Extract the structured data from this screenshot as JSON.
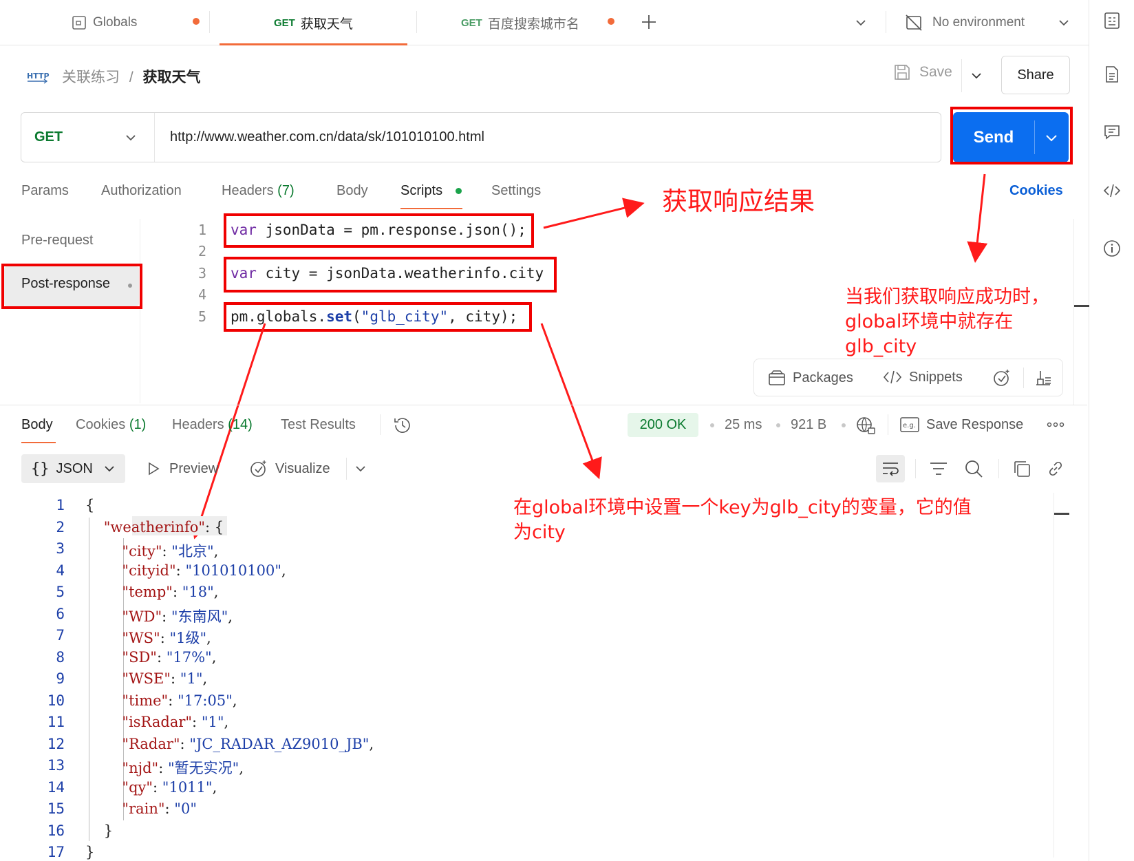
{
  "tabs": [
    {
      "label": "Globals",
      "method": "",
      "dirty": true
    },
    {
      "label": "获取天气",
      "method": "GET",
      "dirty": false,
      "active": true
    },
    {
      "label": "百度搜索城市名",
      "method": "GET",
      "dirty": true
    }
  ],
  "environment": {
    "label": "No environment"
  },
  "breadcrumb": {
    "protocol": "HTTP",
    "collection": "关联练习",
    "separator": "/",
    "request": "获取天气"
  },
  "toolbar": {
    "save_label": "Save",
    "share_label": "Share"
  },
  "request": {
    "method": "GET",
    "url": "http://www.weather.com.cn/data/sk/101010100.html",
    "send_label": "Send",
    "tabs": [
      {
        "label": "Params"
      },
      {
        "label": "Authorization"
      },
      {
        "label": "Headers",
        "count": "(7)"
      },
      {
        "label": "Body"
      },
      {
        "label": "Scripts"
      },
      {
        "label": "Settings"
      }
    ],
    "cookies_label": "Cookies"
  },
  "scripts": {
    "pre_label": "Pre-request",
    "post_label": "Post-response",
    "line_numbers": [
      "1",
      "2",
      "3",
      "4",
      "5"
    ],
    "lines": [
      "var jsonData = pm.response.json();",
      "",
      "var city = jsonData.weatherinfo.city",
      "",
      "pm.globals.set(\"glb_city\", city);"
    ]
  },
  "snippets_bar": {
    "packages_label": "Packages",
    "snippets_label": "Snippets"
  },
  "annotations": {
    "response_result": "获取响应结果",
    "success_note": [
      "当我们获取响应成功时，",
      "global环境中就存在",
      "glb_city"
    ],
    "set_note": [
      "在global环境中设置一个key为glb_city的变量，它的值",
      "为city"
    ]
  },
  "response": {
    "tabs": [
      {
        "label": "Body"
      },
      {
        "label": "Cookies",
        "count": "(1)"
      },
      {
        "label": "Headers",
        "count": "(14)"
      },
      {
        "label": "Test Results"
      }
    ],
    "status": "200 OK",
    "time": "25 ms",
    "size": "921 B",
    "save_label": "Save Response",
    "format": "JSON",
    "preview_label": "Preview",
    "visualize_label": "Visualize",
    "json_line_numbers": [
      "1",
      "2",
      "3",
      "4",
      "5",
      "6",
      "7",
      "8",
      "9",
      "10",
      "11",
      "12",
      "13",
      "14",
      "15",
      "16",
      "17"
    ],
    "json_lines": [
      "{",
      "    \"weatherinfo\": {",
      "        \"city\": \"北京\",",
      "        \"cityid\": \"101010100\",",
      "        \"temp\": \"18\",",
      "        \"WD\": \"东南风\",",
      "        \"WS\": \"1级\",",
      "        \"SD\": \"17%\",",
      "        \"WSE\": \"1\",",
      "        \"time\": \"17:05\",",
      "        \"isRadar\": \"1\",",
      "        \"Radar\": \"JC_RADAR_AZ9010_JB\",",
      "        \"njd\": \"暂无实况\",",
      "        \"qy\": \"1011\",",
      "        \"rain\": \"0\"",
      "    }",
      "}"
    ]
  },
  "colors": {
    "accent": "#f26b3a",
    "send": "#0b6ef0",
    "annotation": "#ff1a1a",
    "method_get": "#0b7a2f"
  }
}
